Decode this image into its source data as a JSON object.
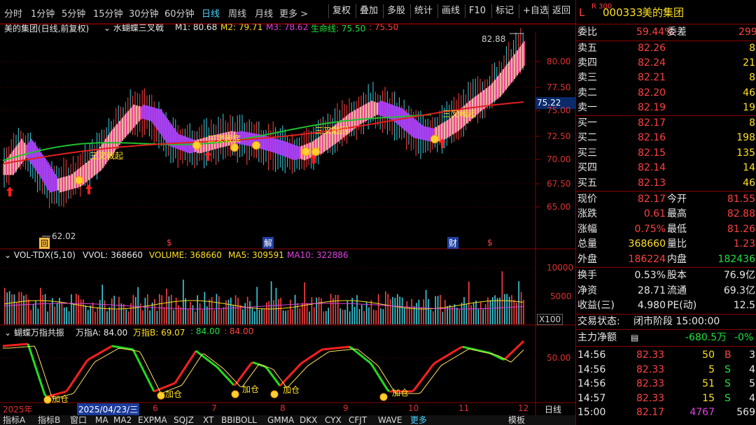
{
  "toolbar": {
    "periods": [
      "分时",
      "1分钟",
      "5分钟",
      "15分钟",
      "30分钟",
      "60分钟",
      "日线",
      "周线",
      "月线",
      "更多 >"
    ],
    "active_period": "日线",
    "buttons": [
      "复权",
      "叠加",
      "多股",
      "统计",
      "画线",
      "F10",
      "标记",
      "+自选",
      "返回"
    ]
  },
  "main": {
    "title": "美的集团(日线,前复权)",
    "indicator_name": "水蝴蝶三叉戟",
    "m1": "M1: 80.68",
    "m2": "M2: 79.71",
    "m3": "M3: 78.62",
    "life_line": "生命线: 75.50",
    "extra": ": 75.50",
    "price_axis": [
      "80.00",
      "77.50",
      "75.00",
      "72.50",
      "70.00",
      "67.50",
      "65.00"
    ],
    "current_price_tag": "75.22",
    "high_label": "82.88",
    "low_label": "62.02",
    "annotations": [
      "三叉戟起",
      "三叉戟底",
      "三叉戟回",
      "三叉戟起"
    ],
    "event_markers": [
      "回",
      "解",
      "财",
      "$",
      "$"
    ]
  },
  "volume": {
    "title": "VOL-TDX(5,10)",
    "vvol": "VVOL: 368660",
    "volume": "VOLUME: 368660",
    "ma5": "MA5: 309591",
    "ma10": "MA10: 322886",
    "axis": [
      "10000",
      "5000"
    ],
    "unit": "X100"
  },
  "oscillator": {
    "title": "蝴蝶万指共振",
    "a": "万指A: 84.00",
    "b": "万指B: 69.07",
    "c": ": 84.00",
    "d": ": 84.00",
    "axis": "50.00",
    "signal_label": "加仓"
  },
  "dates": {
    "year": "2025年",
    "selected": "2025/04/23/三",
    "months": [
      "6",
      "7",
      "8",
      "9",
      "10",
      "11",
      "12"
    ],
    "day_button": "日线"
  },
  "bottom_tabs": [
    "指标A",
    "指标B",
    "窗口",
    "MA",
    "MA2",
    "EXPMA",
    "SQJZ",
    "XT",
    "BBIBOLL",
    "GMMA",
    "DKX",
    "CYX",
    "CFJT",
    "WAVE",
    "更多",
    "模板"
  ],
  "quote": {
    "market_tag": "L",
    "index_tag": "R 300",
    "code": "000333",
    "name": "美的集团",
    "weibi_label": "委比",
    "weibi": "59.44%",
    "weicha_label": "委差",
    "weicha": "299",
    "asks": [
      {
        "label": "卖五",
        "price": "82.26",
        "vol": "8"
      },
      {
        "label": "卖四",
        "price": "82.24",
        "vol": "21"
      },
      {
        "label": "卖三",
        "price": "82.21",
        "vol": "8"
      },
      {
        "label": "卖二",
        "price": "82.20",
        "vol": "46"
      },
      {
        "label": "卖一",
        "price": "82.19",
        "vol": "19"
      }
    ],
    "bids": [
      {
        "label": "买一",
        "price": "82.17",
        "vol": "8"
      },
      {
        "label": "买二",
        "price": "82.16",
        "vol": "198"
      },
      {
        "label": "买三",
        "price": "82.15",
        "vol": "135"
      },
      {
        "label": "买四",
        "price": "82.14",
        "vol": "14"
      },
      {
        "label": "买五",
        "price": "82.13",
        "vol": "46"
      }
    ],
    "stats": [
      {
        "l1": "现价",
        "v1": "82.17",
        "c1": "red",
        "l2": "今开",
        "v2": "81.55",
        "c2": "red"
      },
      {
        "l1": "涨跌",
        "v1": "0.61",
        "c1": "red",
        "l2": "最高",
        "v2": "82.88",
        "c2": "red"
      },
      {
        "l1": "涨幅",
        "v1": "0.75%",
        "c1": "red",
        "l2": "最低",
        "v2": "81.26",
        "c2": "red"
      },
      {
        "l1": "总量",
        "v1": "368660",
        "c1": "yellow",
        "l2": "量比",
        "v2": "1.23",
        "c2": "red"
      },
      {
        "l1": "外盘",
        "v1": "186224",
        "c1": "red",
        "l2": "内盘",
        "v2": "182436",
        "c2": "green"
      }
    ],
    "finance": [
      {
        "l1": "换手",
        "v1": "0.53%",
        "l2": "股本",
        "v2": "76.9亿"
      },
      {
        "l1": "净资",
        "v1": "28.71",
        "l2": "流通",
        "v2": "69.3亿"
      },
      {
        "l1": "收益(三)",
        "v1": "4.980",
        "l2": "PE(动)",
        "v2": "12.5"
      }
    ],
    "trade_status_label": "交易状态:",
    "trade_status": "闭市阶段 15:00:00",
    "main_flow_label": "主力净额",
    "main_flow": "-680.5万",
    "main_flow_pct": "-0%",
    "ticks": [
      {
        "time": "14:56",
        "price": "82.33",
        "vol": "50",
        "side": "B",
        "extra": "3"
      },
      {
        "time": "14:56",
        "price": "82.33",
        "vol": "5",
        "side": "S",
        "extra": "4"
      },
      {
        "time": "14:56",
        "price": "82.33",
        "vol": "51",
        "side": "S",
        "extra": "5"
      },
      {
        "time": "14:57",
        "price": "82.33",
        "vol": "15",
        "side": "S",
        "extra": "4"
      },
      {
        "time": "15:00",
        "price": "82.17",
        "vol": "4767",
        "side": "",
        "extra": "569"
      }
    ]
  },
  "colors": {
    "up": "#ff4040",
    "down": "#20e040",
    "frame": "#8b0000",
    "accent": "#4ad0ff",
    "yellow": "#ffe020"
  }
}
